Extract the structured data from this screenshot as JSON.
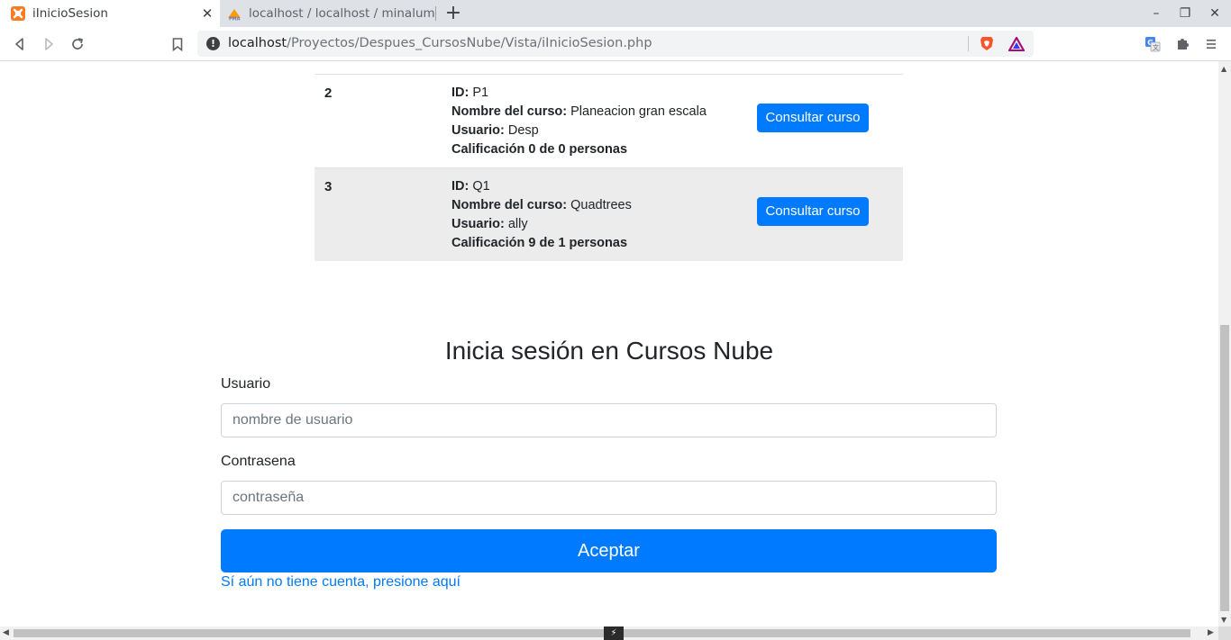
{
  "browser": {
    "tabs": [
      {
        "title": "iInicioSesion",
        "favicon": "xampp-icon",
        "active": true
      },
      {
        "title": "localhost / localhost / minalum",
        "favicon": "phpmyadmin-icon",
        "active": false
      }
    ],
    "url_host": "localhost",
    "url_path": "/Proyectos/Despues_CursosNube/Vista/iInicioSesion.php"
  },
  "courses": [
    {
      "num": "2",
      "id_label": "ID:",
      "id": "P1",
      "name_label": "Nombre del curso:",
      "name": "Planeacion gran escala",
      "user_label": "Usuario:",
      "user": "Desp",
      "rating": "Calificación 0 de 0 personas",
      "button": "Consultar curso"
    },
    {
      "num": "3",
      "id_label": "ID:",
      "id": "Q1",
      "name_label": "Nombre del curso:",
      "name": "Quadtrees",
      "user_label": "Usuario:",
      "user": "ally",
      "rating": "Calificación 9 de 1 personas",
      "button": "Consultar curso"
    }
  ],
  "login": {
    "title": "Inicia sesión en Cursos Nube",
    "user_label": "Usuario",
    "user_placeholder": "nombre de usuario",
    "pass_label": "Contrasena",
    "pass_placeholder": "contraseña",
    "submit": "Aceptar",
    "signup_link": "Sí aún no tiene cuenta, presione aquí"
  },
  "colors": {
    "primary": "#007bff",
    "row_stripe": "#ececec"
  }
}
